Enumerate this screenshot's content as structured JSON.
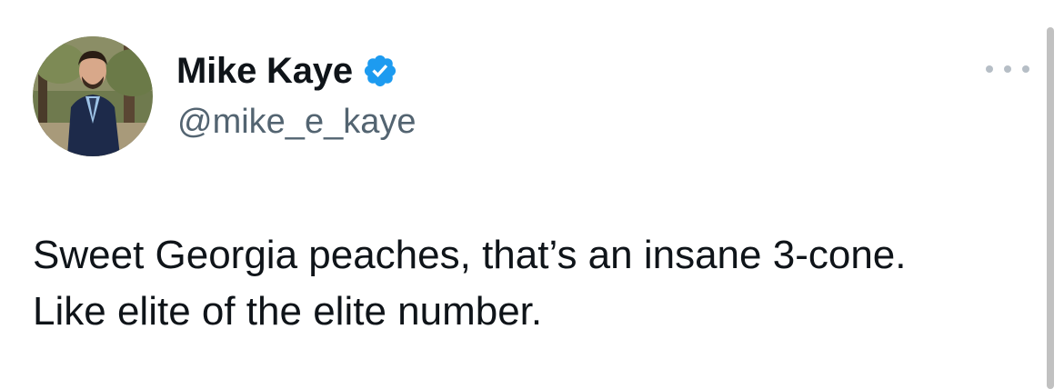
{
  "author": {
    "display_name": "Mike Kaye",
    "handle": "@mike_e_kaye",
    "verified": true,
    "avatar": "profile-photo"
  },
  "tweet": {
    "text": "Sweet Georgia peaches, that’s an insane 3-cone. Like elite of the elite number."
  },
  "icons": {
    "verified": "verified-badge-icon",
    "more": "more-options-icon"
  },
  "colors": {
    "text_primary": "#0f1419",
    "text_secondary": "#536471",
    "verified_blue": "#1d9bf0",
    "background": "#ffffff"
  }
}
